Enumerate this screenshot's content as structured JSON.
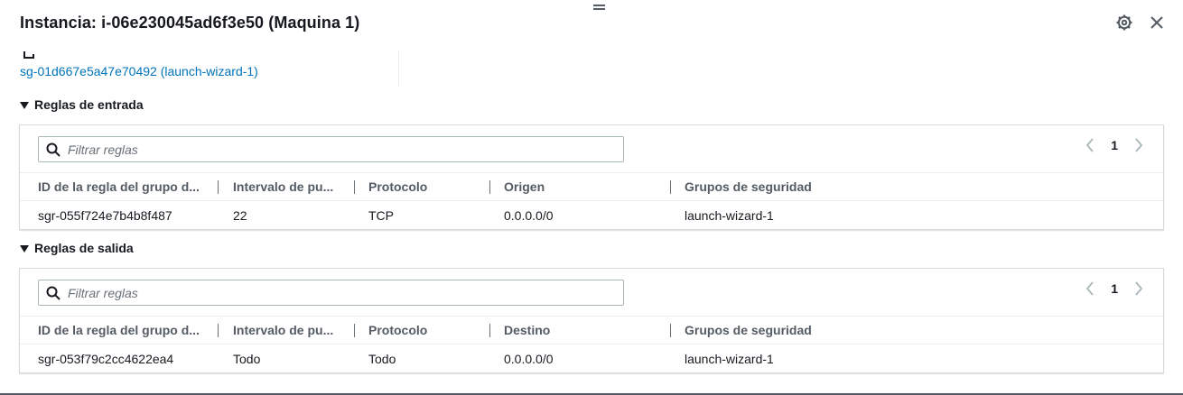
{
  "header": {
    "title": "Instancia: i-06e230045ad6f3e50 (Maquina 1)"
  },
  "security_group": {
    "link": "sg-01d667e5a47e70492 (launch-wizard-1)"
  },
  "inbound": {
    "title": "Reglas de entrada",
    "filter_placeholder": "Filtrar reglas",
    "page": "1",
    "columns": [
      "ID de la regla del grupo d...",
      "Intervalo de pu...",
      "Protocolo",
      "Origen",
      "Grupos de seguridad"
    ],
    "rows": [
      [
        "sgr-055f724e7b4b8f487",
        "22",
        "TCP",
        "0.0.0.0/0",
        "launch-wizard-1"
      ]
    ]
  },
  "outbound": {
    "title": "Reglas de salida",
    "filter_placeholder": "Filtrar reglas",
    "page": "1",
    "columns": [
      "ID de la regla del grupo d...",
      "Intervalo de pu...",
      "Protocolo",
      "Destino",
      "Grupos de seguridad"
    ],
    "rows": [
      [
        "sgr-053f79c2cc4622ea4",
        "Todo",
        "Todo",
        "0.0.0.0/0",
        "launch-wizard-1"
      ]
    ]
  },
  "colors": {
    "link": "#0073bb",
    "text": "#16191f",
    "header_text": "#545b64",
    "border": "#d5dbdb"
  },
  "icons": {
    "settings": "gear-icon",
    "close": "close-icon",
    "search": "search-icon",
    "prev": "chevron-left-icon",
    "next": "chevron-right-icon",
    "copy": "copy-icon",
    "expand": "caret-down-icon"
  }
}
